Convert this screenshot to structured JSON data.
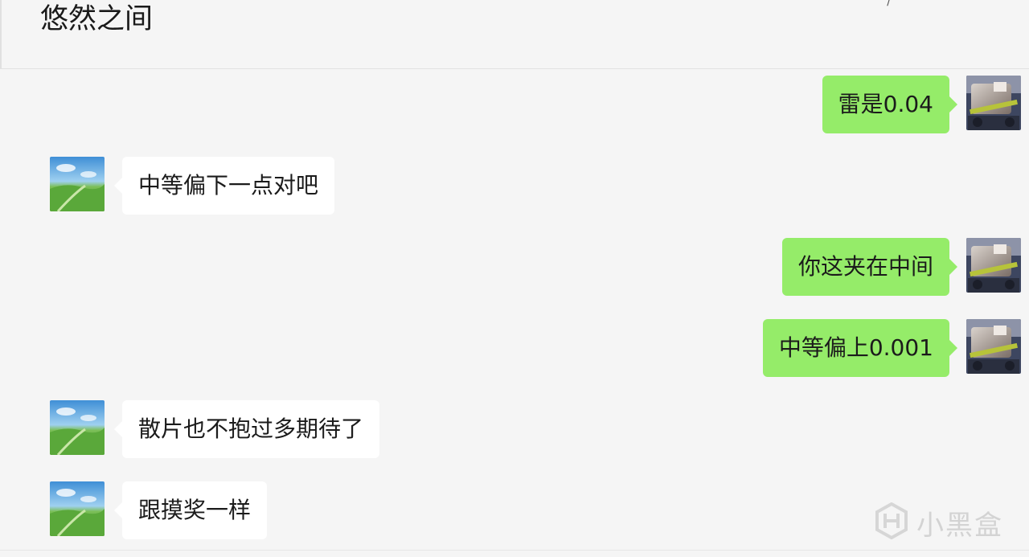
{
  "chat": {
    "title": "悠然之间",
    "top_glyph": "/"
  },
  "messages": [
    {
      "side": "out",
      "text": "雷是0.04"
    },
    {
      "side": "in",
      "text": "中等偏下一点对吧"
    },
    {
      "side": "out",
      "text": "你这夹在中间"
    },
    {
      "side": "out",
      "text": "中等偏上0.001"
    },
    {
      "side": "in",
      "text": "散片也不抱过多期待了"
    },
    {
      "side": "in",
      "text": "跟摸奖一样"
    }
  ],
  "watermark": {
    "icon": "heybox-logo-icon",
    "text": "小黑盒"
  },
  "colors": {
    "background": "#f5f5f5",
    "incoming_bubble": "#ffffff",
    "outgoing_bubble": "#95ec69",
    "text": "#1b1b1b"
  }
}
